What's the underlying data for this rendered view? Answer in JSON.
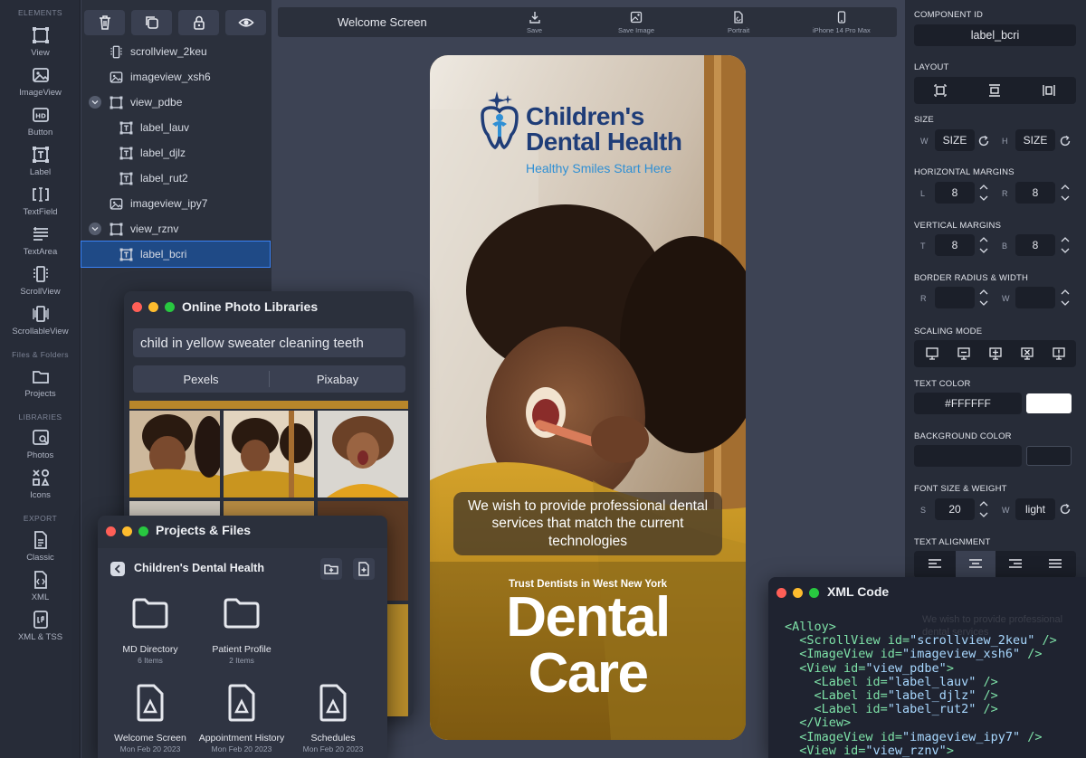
{
  "rail": {
    "sections": [
      "ELEMENTS",
      "Files & Folders",
      "LIBRARIES",
      "EXPORT"
    ],
    "items": [
      "View",
      "ImageView",
      "Button",
      "Label",
      "TextField",
      "TextArea",
      "ScrollView",
      "ScrollableView",
      "Projects",
      "Photos",
      "Icons",
      "Classic",
      "XML",
      "XML & TSS"
    ]
  },
  "tree": {
    "rows": [
      "scrollview_2keu",
      "imageview_xsh6",
      "view_pdbe",
      "label_lauv",
      "label_djlz",
      "label_rut2",
      "imageview_ipy7",
      "view_rznv",
      "label_bcri"
    ]
  },
  "topbar": {
    "title": "Welcome Screen",
    "save": "Save",
    "save_image": "Save Image",
    "portrait": "Portrait",
    "device": "iPhone 14 Pro Max"
  },
  "phone": {
    "logo_line1": "Children's",
    "logo_line2": "Dental Health",
    "tagline": "Healthy Smiles Start Here",
    "message": "We wish to provide professional dental services that match the current technologies",
    "trust": "Trust Dentists in West New York",
    "headline1": "Dental",
    "headline2": "Care"
  },
  "right": {
    "component_id_label": "COMPONENT ID",
    "component_id": "label_bcri",
    "layout_label": "LAYOUT",
    "size_label": "SIZE",
    "w": "W",
    "h": "H",
    "size_w": "SIZE",
    "size_h": "SIZE",
    "hmargins_label": "HORIZONTAL MARGINS",
    "l": "L",
    "r": "R",
    "left_margin": "8",
    "right_margin": "8",
    "vmargins_label": "VERTICAL MARGINS",
    "t": "T",
    "b": "B",
    "top_margin": "8",
    "bottom_margin": "8",
    "border_label": "BORDER RADIUS & WIDTH",
    "scaling_label": "SCALING MODE",
    "text_color_label": "TEXT COLOR",
    "text_color": "#FFFFFF",
    "bg_color_label": "BACKGROUND COLOR",
    "font_label": "FONT SIZE & WEIGHT",
    "s": "S",
    "font_size": "20",
    "font_weight": "light",
    "align_label": "TEXT ALIGNMENT"
  },
  "photos_win": {
    "title": "Online Photo Libraries",
    "search": "child in yellow sweater cleaning teeth",
    "tab1": "Pexels",
    "tab2": "Pixabay"
  },
  "files_win": {
    "title": "Projects & Files",
    "folder": "Children's Dental Health",
    "items": [
      {
        "name": "MD Directory",
        "sub": "6 Items"
      },
      {
        "name": "Patient Profile",
        "sub": "2 Items"
      },
      {
        "name": "Welcome Screen",
        "sub": "Mon Feb 20 2023"
      },
      {
        "name": "Appointment History",
        "sub": "Mon Feb 20 2023"
      },
      {
        "name": "Schedules",
        "sub": "Mon Feb 20 2023"
      }
    ]
  },
  "xml_win": {
    "title": "XML Code",
    "ghost": "We wish to provide professional dental services",
    "lines": [
      "<Alloy>",
      "  <ScrollView id=\"scrollview_2keu\" />",
      "  <ImageView id=\"imageview_xsh6\" />",
      "  <View id=\"view_pdbe\">",
      "    <Label id=\"label_lauv\" />",
      "    <Label id=\"label_djlz\" />",
      "    <Label id=\"label_rut2\" />",
      "  </View>",
      "  <ImageView id=\"imageview_ipy7\" />",
      "  <View id=\"view_rznv\">"
    ]
  },
  "colors": {
    "accent": "#3b82f6",
    "selection": "#1f4a86",
    "logo_navy": "#1f3d78",
    "logo_blue": "#2f8fd4",
    "sweater": "#c9951f",
    "xml_tag": "#7ee2a8",
    "xml_attr": "#a8d8ff"
  }
}
